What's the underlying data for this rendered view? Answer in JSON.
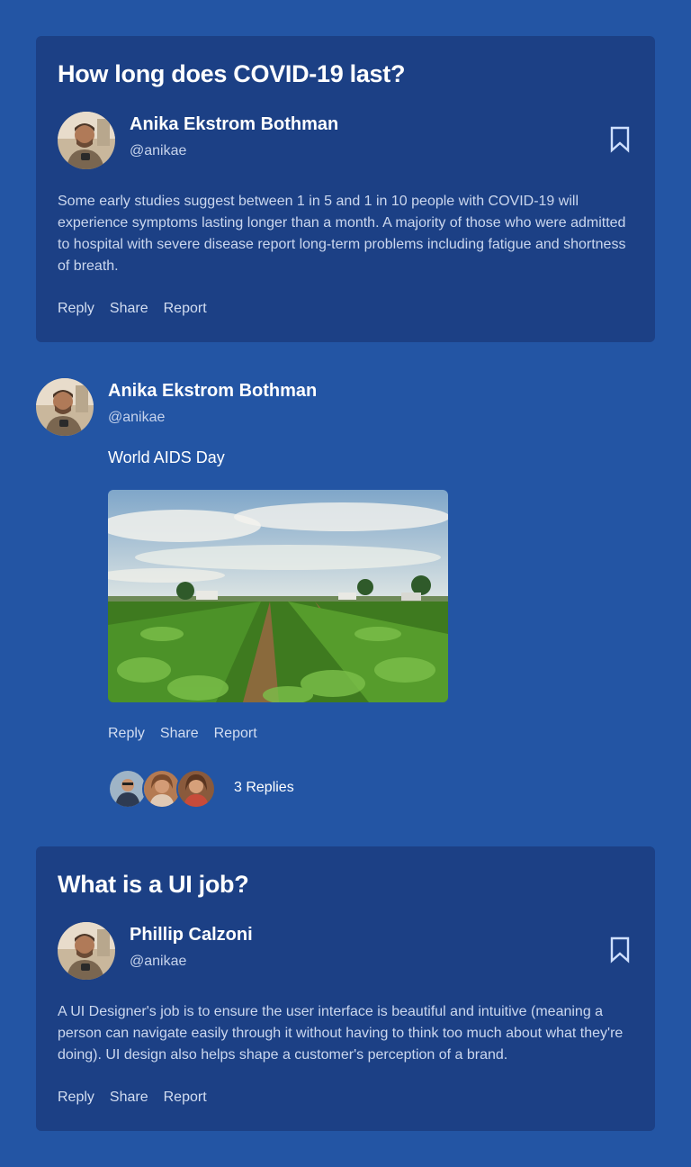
{
  "card1": {
    "title": "How long does COVID-19 last?",
    "author_name": "Anika Ekstrom Bothman",
    "author_handle": "@anikae",
    "body": "Some early studies suggest between 1 in 5 and 1 in 10 people with COVID-19 will experience symptoms lasting longer than a month. A majority of those who were admitted to hospital with severe disease report long-term problems including fatigue and shortness of breath.",
    "actions": {
      "reply": "Reply",
      "share": "Share",
      "report": "Report"
    },
    "bookmark_icon": "bookmark-icon"
  },
  "post": {
    "author_name": "Anika Ekstrom Bothman",
    "author_handle": "@anikae",
    "text": "World AIDS Day",
    "actions": {
      "reply": "Reply",
      "share": "Share",
      "report": "Report"
    },
    "replies_label": "3 Replies"
  },
  "card3": {
    "title": "What is a UI job?",
    "author_name": "Phillip Calzoni",
    "author_handle": "@anikae",
    "body": "A UI Designer's job is to ensure the user interface is beautiful and intuitive (meaning a person can navigate easily through it without having to think too much about what they're doing). UI design also helps shape a customer's perception of a brand.",
    "actions": {
      "reply": "Reply",
      "share": "Share",
      "report": "Report"
    },
    "bookmark_icon": "bookmark-icon"
  },
  "colors": {
    "page_bg": "#2355a4",
    "card_bg": "#1c4085",
    "muted_text": "#cbd7ee"
  }
}
